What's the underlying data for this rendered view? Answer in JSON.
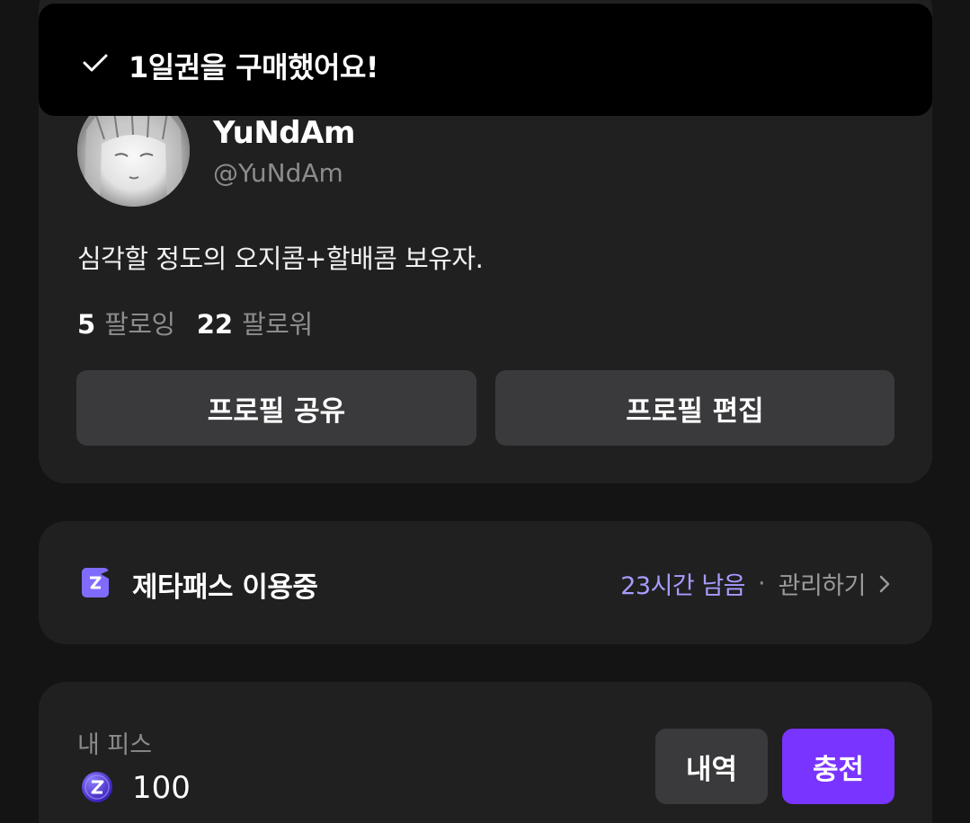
{
  "toast": {
    "message": "1일권을 구매했어요!",
    "icon": "check-icon"
  },
  "profile": {
    "display_name": "YuNdAm",
    "handle": "@YuNdAm",
    "bio": "심각할 정도의 오지콤+할배콤 보유자.",
    "following_count": "5",
    "following_label": "팔로잉",
    "followers_count": "22",
    "followers_label": "팔로워",
    "share_button": "프로필 공유",
    "edit_button": "프로필 편집"
  },
  "pass": {
    "icon": "zeta-pass-icon",
    "title": "제타패스 이용중",
    "remaining": "23시간 남음",
    "separator": "·",
    "manage_label": "관리하기"
  },
  "pieces": {
    "label": "내 피스",
    "count": "100",
    "icon": "coin-icon",
    "history_button": "내역",
    "charge_button": "충전"
  },
  "colors": {
    "background": "#141414",
    "card": "#202020",
    "button": "#3a3a3c",
    "accent": "#7a34ff",
    "remaining_text": "#a79cff"
  }
}
